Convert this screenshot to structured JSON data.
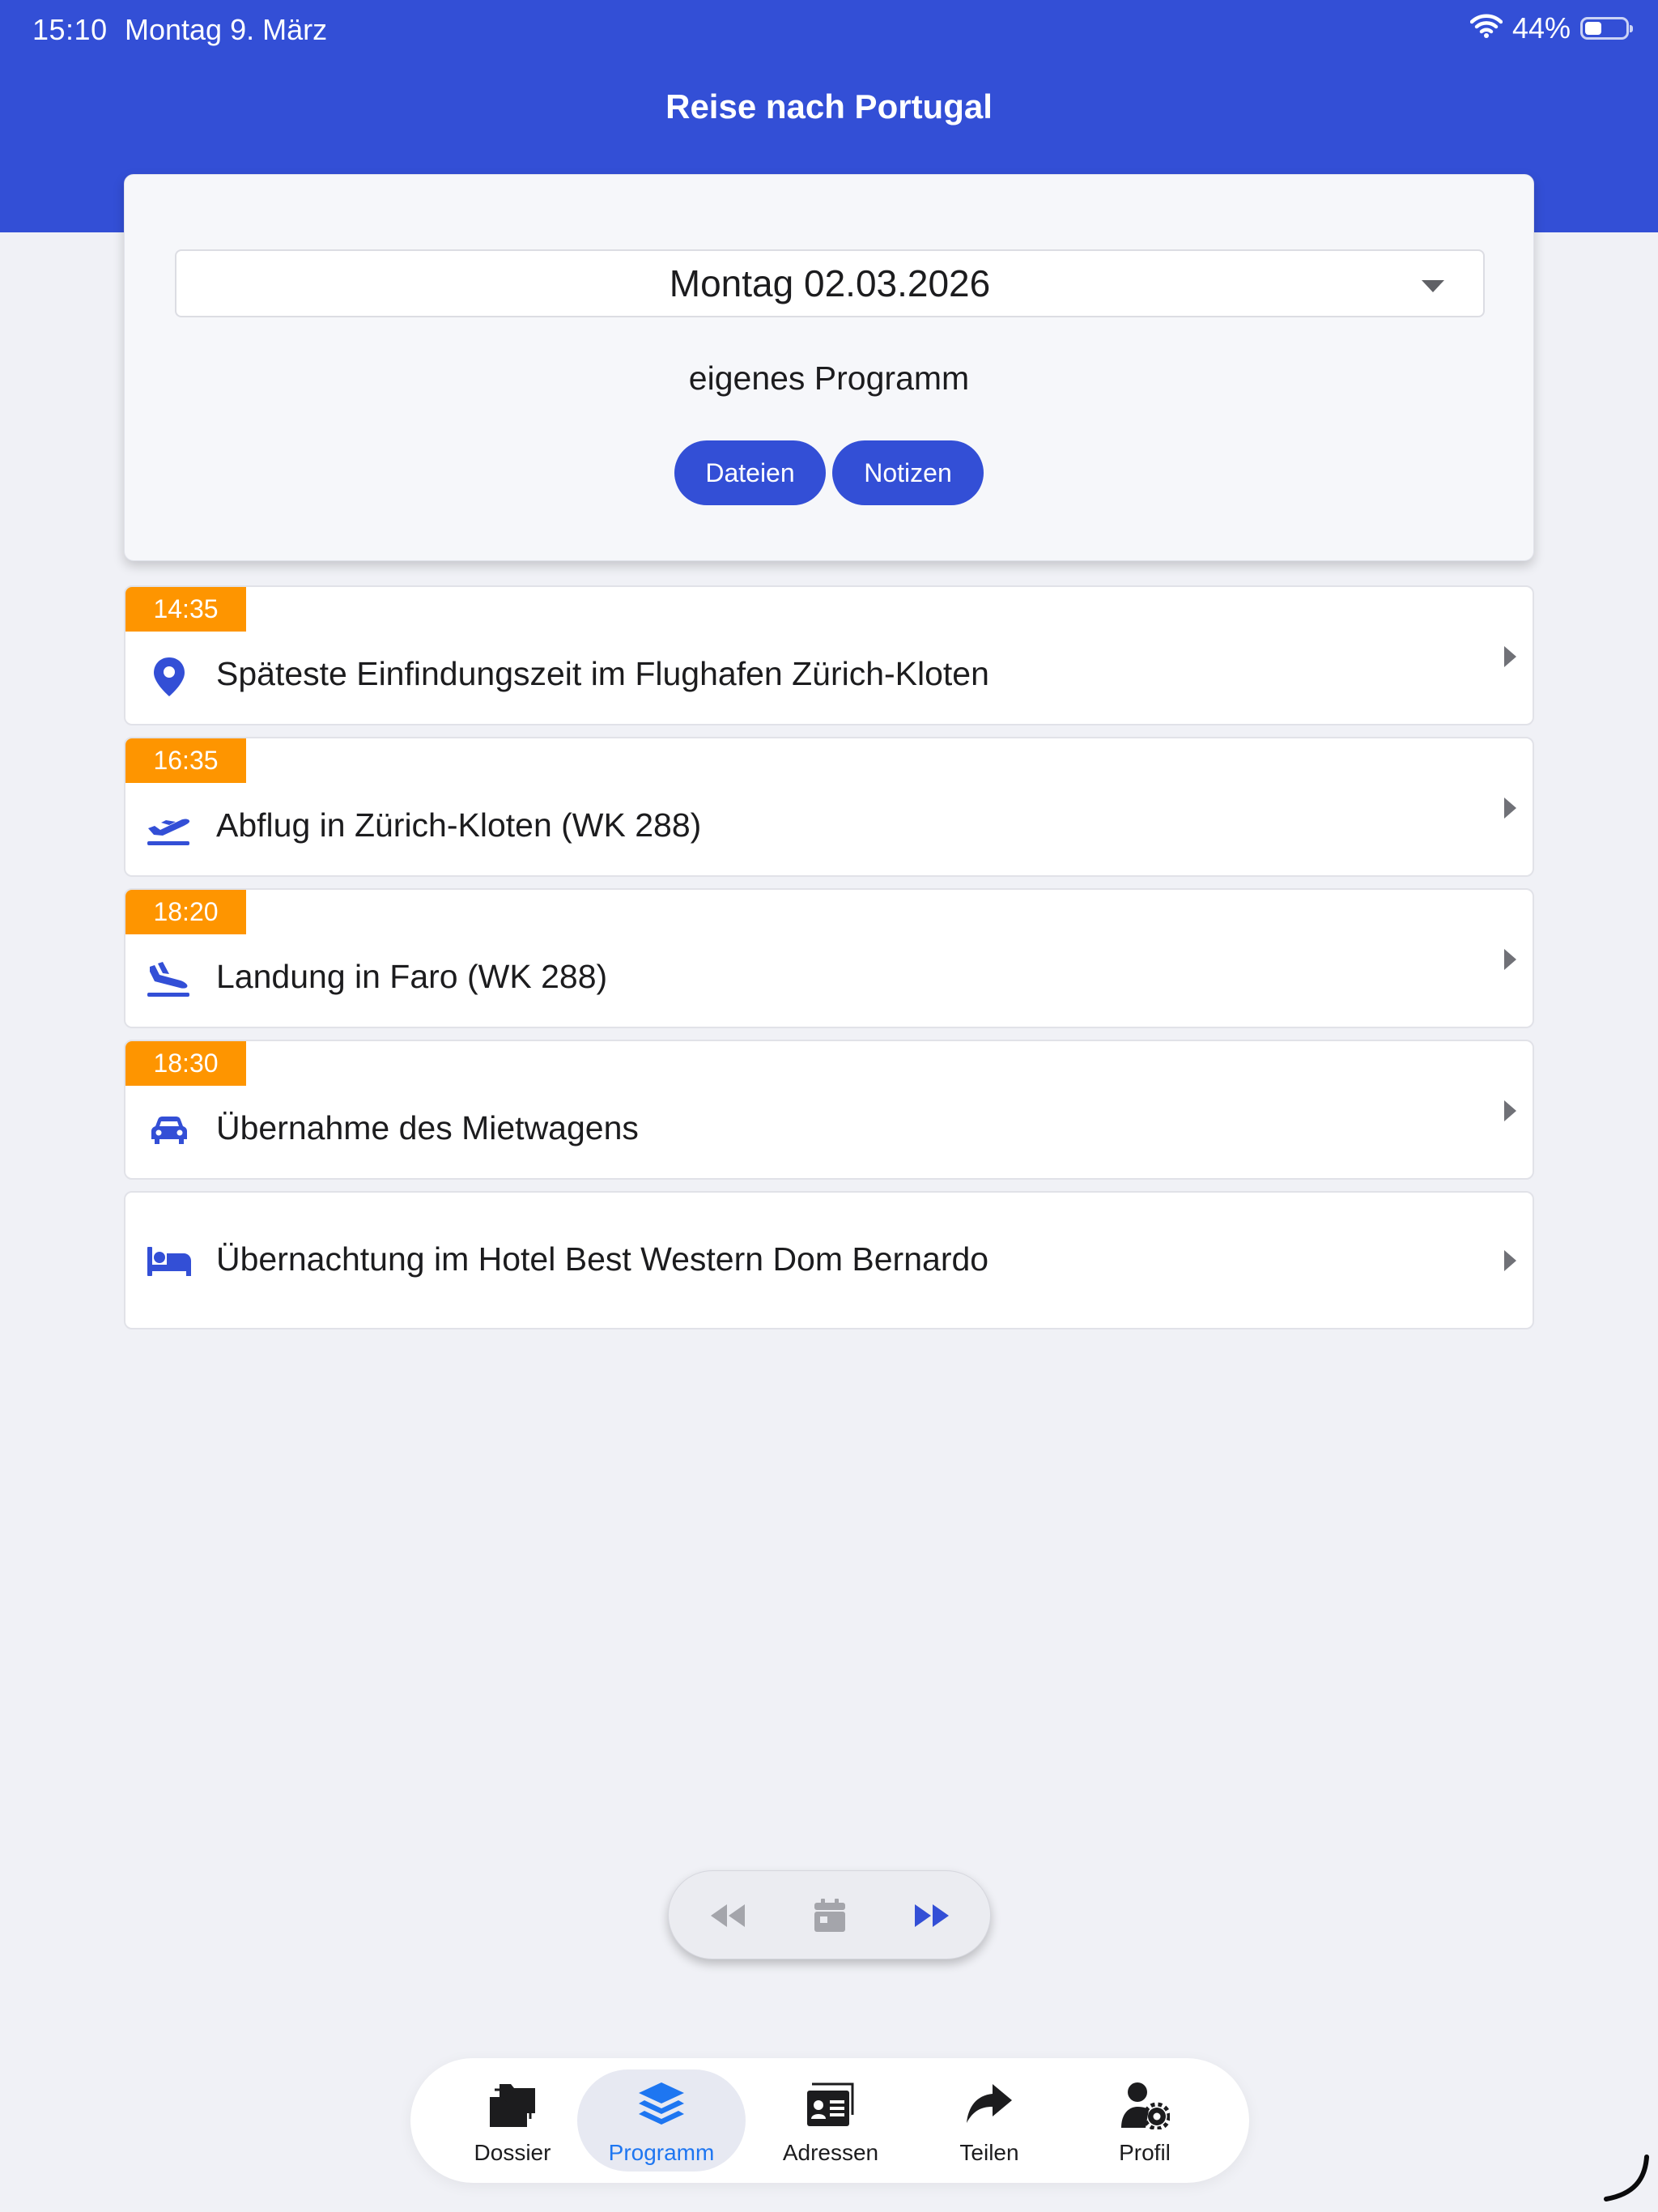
{
  "status_bar": {
    "time": "15:10",
    "date": "Montag 9. März",
    "battery": "44%"
  },
  "header": {
    "title": "Reise nach Portugal"
  },
  "day_card": {
    "selected_day": "Montag 02.03.2026",
    "program_label": "eigenes Programm",
    "files_button": "Dateien",
    "notes_button": "Notizen"
  },
  "events": [
    {
      "time": "14:35",
      "icon": "map-pin-icon",
      "title": "Späteste Einfindungszeit im Flughafen Zürich-Kloten"
    },
    {
      "time": "16:35",
      "icon": "plane-departure-icon",
      "title": "Abflug in Zürich-Kloten (WK 288)"
    },
    {
      "time": "18:20",
      "icon": "plane-arrival-icon",
      "title": "Landung in Faro (WK 288)"
    },
    {
      "time": "18:30",
      "icon": "car-icon",
      "title": "Übernahme des Mietwagens"
    },
    {
      "time": "",
      "icon": "bed-icon",
      "title": "Übernachtung im Hotel Best Western Dom Bernardo"
    }
  ],
  "day_navigation": {
    "prev_icon": "rewind-icon",
    "calendar_icon": "calendar-icon",
    "next_icon": "fast-forward-icon"
  },
  "tabs": [
    {
      "label": "Dossier",
      "icon": "folders-icon",
      "active": false
    },
    {
      "label": "Programm",
      "icon": "layers-icon",
      "active": true
    },
    {
      "label": "Adressen",
      "icon": "address-card-icon",
      "active": false
    },
    {
      "label": "Teilen",
      "icon": "share-icon",
      "active": false
    },
    {
      "label": "Profil",
      "icon": "user-gear-icon",
      "active": false
    }
  ],
  "colors": {
    "primary": "#334fd6",
    "time_tag": "#fe9500",
    "active_tab": "#1e76f1",
    "background": "#f0f1f6"
  }
}
